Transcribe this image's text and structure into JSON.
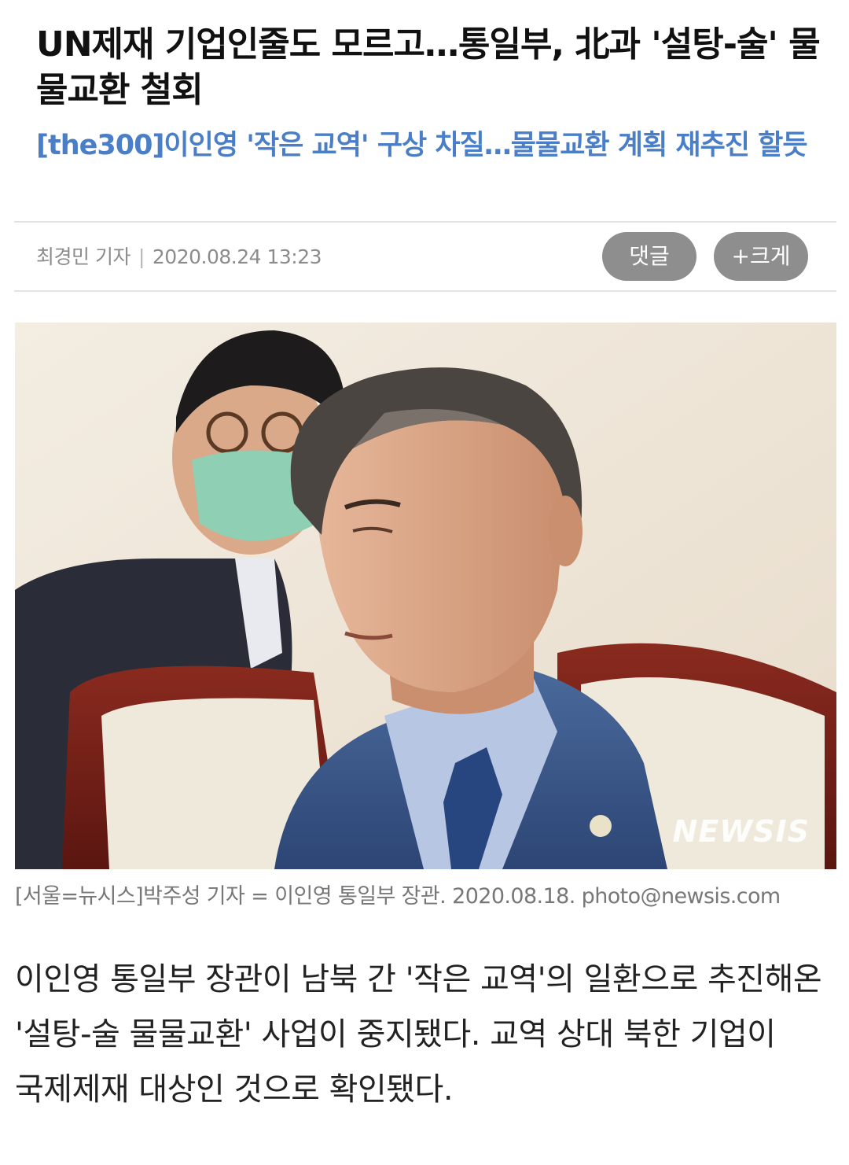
{
  "article": {
    "headline": "UN제재 기업인줄도 모르고…통일부, 北과 '설탕-술' 물물교환 철회",
    "subheadline": "[the300]이인영 '작은 교역' 구상 차질…물물교환 계획 재추진 할듯",
    "byline": {
      "reporter": "최경민 기자",
      "separator": "|",
      "datetime": "2020.08.24 13:23"
    },
    "buttons": {
      "comment": "댓글",
      "font_size": "+크게"
    },
    "photo": {
      "watermark": "NEWSIS",
      "caption": "[서울=뉴시스]박주성 기자 = 이인영 통일부 장관. 2020.08.18. photo@newsis.com"
    },
    "body": "이인영 통일부 장관이 남북 간 '작은 교역'의 일환으로 추진해온 '설탕-술 물물교환' 사업이 중지됐다. 교역 상대 북한 기업이 국제제재 대상인 것으로 확인됐다."
  },
  "colors": {
    "subheadline": "#4a7fc7",
    "pill_background": "#8e8e8e",
    "divider": "#e3e3e3",
    "byline": "#8c8c8c",
    "caption": "#777777"
  }
}
